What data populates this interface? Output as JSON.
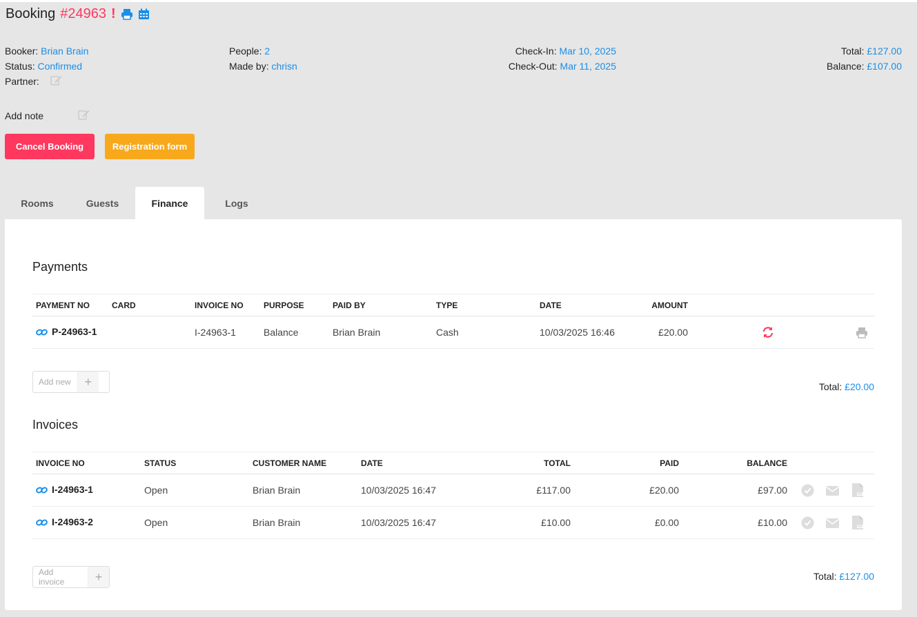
{
  "header": {
    "title": "Booking",
    "number": "#24963",
    "alert": "!",
    "print_icon": "print-icon",
    "calendar_icon": "calendar-icon"
  },
  "meta": {
    "booker_label": "Booker:",
    "booker_value": "Brian Brain",
    "status_label": "Status:",
    "status_value": "Confirmed",
    "partner_label": "Partner:",
    "people_label": "People:",
    "people_value": "2",
    "made_by_label": "Made by:",
    "made_by_value": "chrisn",
    "checkin_label": "Check-In:",
    "checkin_value": "Mar 10, 2025",
    "checkout_label": "Check-Out:",
    "checkout_value": "Mar 11, 2025",
    "total_label": "Total:",
    "total_value": "£127.00",
    "balance_label": "Balance:",
    "balance_value": "£107.00"
  },
  "note": {
    "label": "Add note"
  },
  "actions": {
    "cancel_label": "Cancel Booking",
    "registration_label": "Registration form"
  },
  "tabs": [
    {
      "label": "Rooms"
    },
    {
      "label": "Guests"
    },
    {
      "label": "Finance"
    },
    {
      "label": "Logs"
    }
  ],
  "payments": {
    "title": "Payments",
    "columns": [
      "PAYMENT NO",
      "CARD",
      "INVOICE NO",
      "PURPOSE",
      "PAID BY",
      "TYPE",
      "DATE",
      "AMOUNT"
    ],
    "rows": [
      {
        "payment_no": "P-24963-1",
        "card": "",
        "invoice_no": "I-24963-1",
        "purpose": "Balance",
        "paid_by": "Brian Brain",
        "type": "Cash",
        "date": "10/03/2025 16:46",
        "amount": "£20.00"
      }
    ],
    "add_label": "Add new",
    "total_label": "Total:",
    "total_value": "£20.00"
  },
  "invoices": {
    "title": "Invoices",
    "columns": [
      "INVOICE NO",
      "STATUS",
      "CUSTOMER NAME",
      "DATE",
      "TOTAL",
      "PAID",
      "BALANCE"
    ],
    "rows": [
      {
        "invoice_no": "I-24963-1",
        "status": "Open",
        "customer": "Brian Brain",
        "date": "10/03/2025 16:47",
        "total": "£117.00",
        "paid": "£20.00",
        "balance": "£97.00"
      },
      {
        "invoice_no": "I-24963-2",
        "status": "Open",
        "customer": "Brian Brain",
        "date": "10/03/2025 16:47",
        "total": "£10.00",
        "paid": "£0.00",
        "balance": "£10.00"
      }
    ],
    "add_label": "Add invoice",
    "total_label": "Total:",
    "total_value": "£127.00"
  },
  "colors": {
    "accent": "#1a8ee8",
    "danger": "#ff3860",
    "warning": "#f7a81b"
  }
}
